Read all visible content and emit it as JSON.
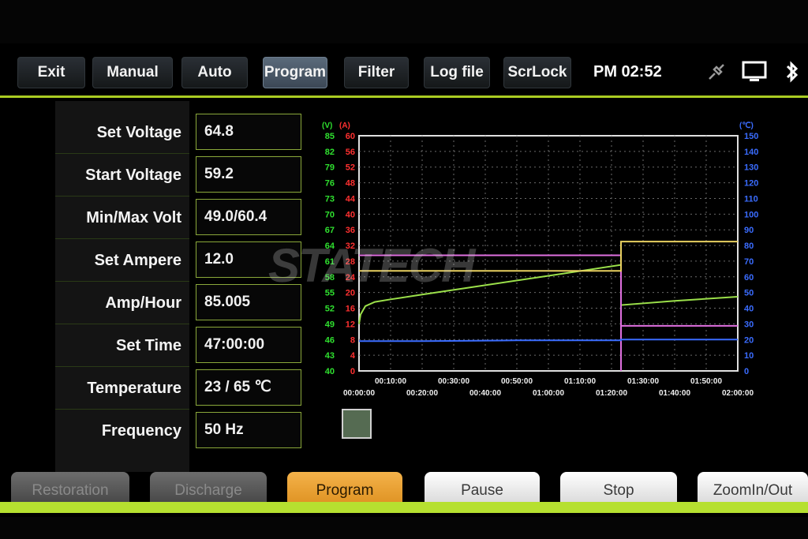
{
  "topbar": {
    "buttons": [
      {
        "label": "Exit"
      },
      {
        "label": "Manual"
      },
      {
        "label": "Auto"
      },
      {
        "label": "Program"
      },
      {
        "label": "Filter"
      },
      {
        "label": "Log file"
      },
      {
        "label": "ScrLock"
      }
    ],
    "active": "Program",
    "clock": "PM 02:52",
    "icons": [
      "usb-plug-icon",
      "monitor-icon",
      "bluetooth-icon"
    ]
  },
  "params": [
    {
      "label": "Set Voltage",
      "value": "64.8"
    },
    {
      "label": "Start Voltage",
      "value": "59.2"
    },
    {
      "label": "Min/Max Volt",
      "value": "49.0/60.4"
    },
    {
      "label": "Set Ampere",
      "value": "12.0"
    },
    {
      "label": "Amp/Hour",
      "value": "85.005"
    },
    {
      "label": "Set Time",
      "value": "47:00:00"
    },
    {
      "label": "Temperature",
      "value": "23 / 65 ℃"
    },
    {
      "label": "Frequency",
      "value": "50 Hz"
    }
  ],
  "watermark": "STATECH",
  "bottom_buttons": [
    {
      "label": "Restoration"
    },
    {
      "label": "Discharge"
    },
    {
      "label": "Program"
    },
    {
      "label": "Pause"
    },
    {
      "label": "Stop"
    },
    {
      "label": "ZoomIn/Out"
    }
  ],
  "colors": {
    "accent": "#aacc22",
    "volt_axis": "#2fe02f",
    "amp_axis": "#ff3030",
    "temp_axis": "#3a6cff",
    "voltage_line": "#9be04a",
    "current_line": "#e070e0",
    "set_line": "#e8d060",
    "temp_line": "#3a6cff"
  },
  "chart_data": {
    "type": "line",
    "axis_units": {
      "volt": "(V)",
      "amp": "(A)",
      "temp": "(℃)"
    },
    "volt_ticks": [
      85,
      82,
      79,
      76,
      73,
      70,
      67,
      64,
      61,
      58,
      55,
      52,
      49,
      46,
      43,
      40
    ],
    "amp_ticks": [
      60,
      56,
      52,
      48,
      44,
      40,
      36,
      32,
      28,
      24,
      20,
      16,
      12,
      8,
      4,
      0
    ],
    "temp_ticks": [
      150,
      140,
      130,
      120,
      110,
      100,
      90,
      80,
      70,
      60,
      50,
      40,
      30,
      20,
      10,
      0
    ],
    "x_ticks_top": [
      "00:10:00",
      "00:30:00",
      "00:50:00",
      "01:10:00",
      "01:30:00",
      "01:50:00"
    ],
    "x_ticks_bottom": [
      "00:00:00",
      "00:20:00",
      "00:40:00",
      "01:00:00",
      "01:20:00",
      "01:40:00",
      "02:00:00"
    ],
    "xlim_min": [
      0,
      120
    ],
    "grid": true,
    "series": [
      {
        "axis": "volt",
        "color": "#9be04a",
        "points": [
          [
            0,
            49
          ],
          [
            0.5,
            50.8
          ],
          [
            2,
            52.4
          ],
          [
            5,
            53.2
          ],
          [
            10,
            53.7
          ],
          [
            20,
            54.6
          ],
          [
            40,
            56.4
          ],
          [
            60,
            58.2
          ],
          [
            83,
            60.3
          ],
          [
            83,
            52.6
          ],
          [
            100,
            53.4
          ],
          [
            120,
            54.2
          ]
        ]
      },
      {
        "axis": "amp",
        "color": "#e070e0",
        "points": [
          [
            0,
            29.5
          ],
          [
            83,
            29.5
          ],
          [
            83,
            0
          ],
          [
            83,
            11.5
          ],
          [
            120,
            11.5
          ]
        ]
      },
      {
        "axis": "amp",
        "color": "#e8d060",
        "points": [
          [
            0,
            25.5
          ],
          [
            83,
            25.5
          ],
          [
            83,
            33
          ],
          [
            120,
            33
          ]
        ]
      },
      {
        "axis": "temp",
        "color": "#3a6cff",
        "points": [
          [
            0,
            19
          ],
          [
            20,
            19
          ],
          [
            50,
            19.5
          ],
          [
            83,
            19.5
          ],
          [
            83,
            20
          ],
          [
            120,
            20
          ]
        ]
      }
    ]
  }
}
